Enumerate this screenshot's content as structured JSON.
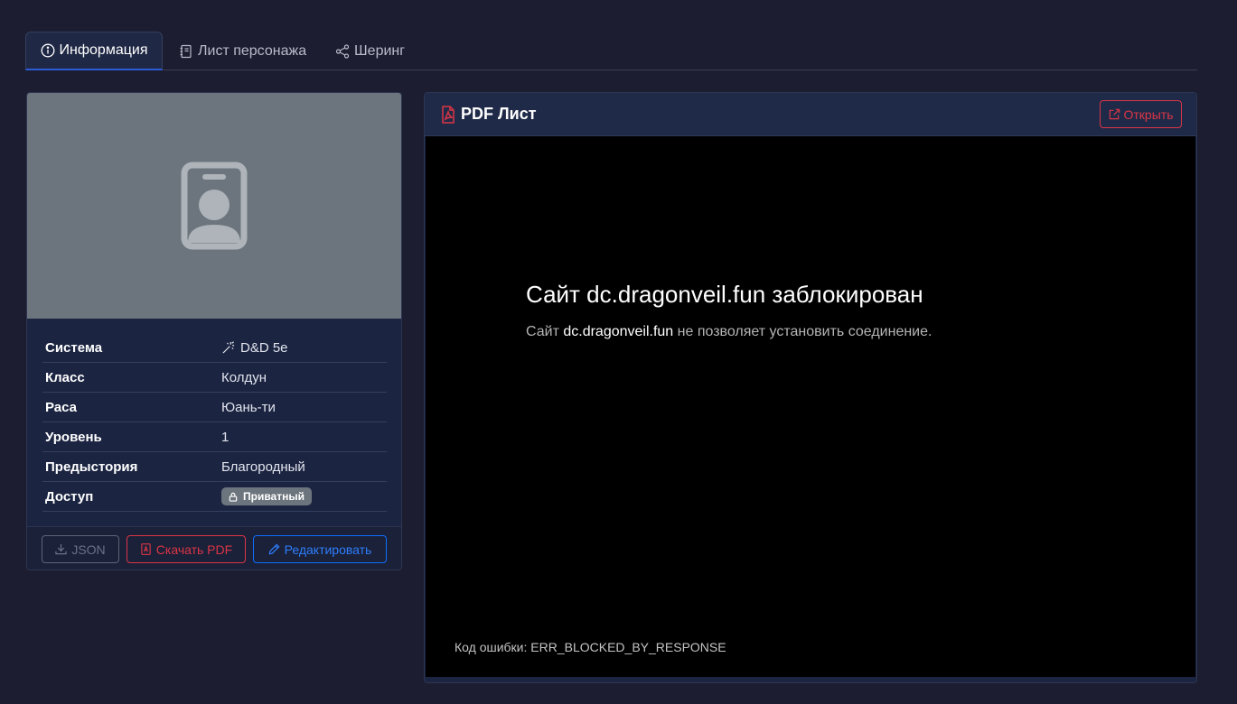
{
  "tabs": [
    {
      "label": "Информация",
      "icon": "info-circle-icon",
      "active": true
    },
    {
      "label": "Лист персонажа",
      "icon": "journal-icon",
      "active": false
    },
    {
      "label": "Шеринг",
      "icon": "share-icon",
      "active": false
    }
  ],
  "character": {
    "avatar_icon": "person-badge-icon",
    "rows": [
      {
        "key": "Система",
        "value": "D&D 5e",
        "icon": "magic-wand-icon"
      },
      {
        "key": "Класс",
        "value": "Колдун"
      },
      {
        "key": "Раса",
        "value": "Юань-ти"
      },
      {
        "key": "Уровень",
        "value": "1"
      },
      {
        "key": "Предыстория",
        "value": "Благородный"
      },
      {
        "key": "Доступ",
        "value": "Приватный",
        "icon": "lock-icon"
      }
    ],
    "buttons": {
      "json": "JSON",
      "download_pdf": "Скачать PDF",
      "edit": "Редактировать"
    }
  },
  "pdf_panel": {
    "title": "PDF Лист",
    "open_label": "Открыть",
    "error": {
      "title": "Сайт dc.dragonveil.fun заблокирован",
      "desc_prefix": "Сайт ",
      "desc_host": "dc.dragonveil.fun",
      "desc_suffix": " не позволяет установить соединение.",
      "code": "Код ошибки: ERR_BLOCKED_BY_RESPONSE"
    }
  },
  "colors": {
    "background": "#1c1d30",
    "danger": "#dc3545",
    "primary": "#0d6efd",
    "secondary": "#6c757d"
  }
}
